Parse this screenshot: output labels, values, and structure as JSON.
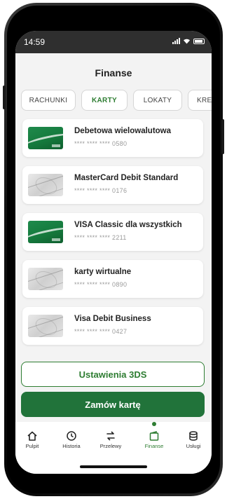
{
  "status_bar": {
    "time": "14:59"
  },
  "header": {
    "title": "Finanse"
  },
  "tabs": [
    {
      "label": "RACHUNKI",
      "active": false
    },
    {
      "label": "KARTY",
      "active": true
    },
    {
      "label": "LOKATY",
      "active": false
    },
    {
      "label": "KREDY",
      "active": false
    }
  ],
  "cards": [
    {
      "name": "Debetowa wielowalutowa",
      "number": "**** **** **** 0580",
      "image": "green"
    },
    {
      "name": "MasterCard Debit Standard",
      "number": "**** **** **** 0176",
      "image": "silver"
    },
    {
      "name": "VISA Classic dla wszystkich",
      "number": "**** **** **** 2211",
      "image": "green"
    },
    {
      "name": "karty wirtualne",
      "number": "**** **** **** 0890",
      "image": "silver"
    },
    {
      "name": "Visa Debit Business",
      "number": "**** **** **** 0427",
      "image": "silver"
    }
  ],
  "actions": {
    "settings_3ds": "Ustawienia 3DS",
    "order_card": "Zamów kartę"
  },
  "bottom_nav": [
    {
      "label": "Pulpit",
      "icon": "home-icon",
      "active": false
    },
    {
      "label": "Historia",
      "icon": "history-icon",
      "active": false
    },
    {
      "label": "Przelewy",
      "icon": "transfer-icon",
      "active": false
    },
    {
      "label": "Finanse",
      "icon": "finance-icon",
      "active": true
    },
    {
      "label": "Usługi",
      "icon": "services-icon",
      "active": false
    }
  ],
  "colors": {
    "accent": "#2e7d32",
    "button_primary": "#21733a",
    "status_bar": "#2f2f2f"
  }
}
